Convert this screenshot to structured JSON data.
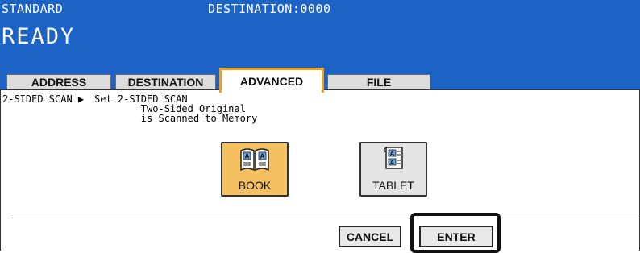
{
  "header": {
    "mode": "STANDARD",
    "destination": "DESTINATION:0000",
    "status": "READY"
  },
  "tabs": [
    {
      "label": "ADDRESS",
      "active": false
    },
    {
      "label": "DESTINATION",
      "active": false
    },
    {
      "label": "ADVANCED",
      "active": true
    },
    {
      "label": "FILE",
      "active": false
    }
  ],
  "description": {
    "label": "2-SIDED SCAN ▶",
    "text": "Set 2-SIDED SCAN\n        Two-Sided Original\n        is Scanned to Memory"
  },
  "options": [
    {
      "label": "BOOK",
      "icon": "book-icon",
      "selected": true,
      "color": "#f4c060"
    },
    {
      "label": "TABLET",
      "icon": "tablet-icon",
      "selected": false,
      "color": "#e4e4e4"
    }
  ],
  "actions": {
    "cancel_label": "CANCEL",
    "enter_label": "ENTER"
  },
  "colors": {
    "header_bg": "#1d63c6",
    "active_tab_border": "#f0a020"
  }
}
